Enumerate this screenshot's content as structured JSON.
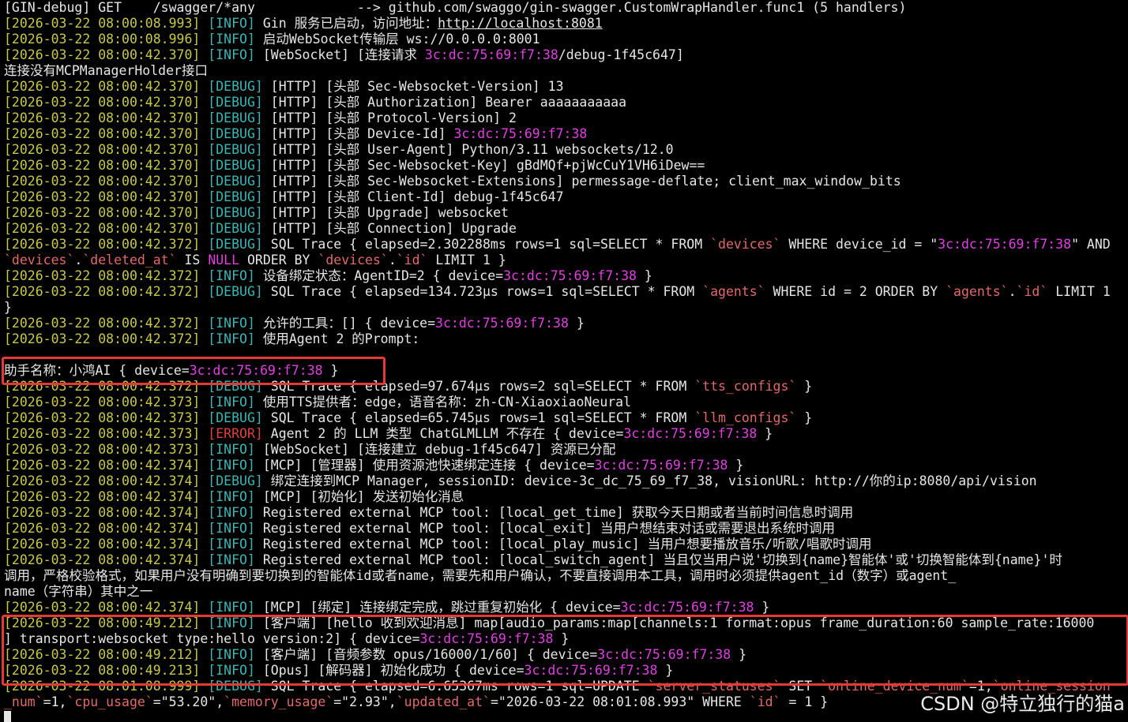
{
  "lines": [
    {
      "segs": [
        {
          "t": "[GIN-debug] GET    /swagger/*any             --> github.com/swaggo/gin-swagger.CustomWrapHandler.func1 (5 handlers)",
          "c": "w"
        }
      ]
    },
    {
      "segs": [
        {
          "t": "[2026-03-22 08:00:08.993]",
          "c": "ts"
        },
        {
          "t": " "
        },
        {
          "t": "[INFO]",
          "c": "info"
        },
        {
          "t": " Gin 服务已启动，访问地址："
        },
        {
          "t": "http://localhost:8081",
          "c": "url"
        }
      ]
    },
    {
      "segs": [
        {
          "t": "[2026-03-22 08:00:08.996]",
          "c": "ts"
        },
        {
          "t": " "
        },
        {
          "t": "[INFO]",
          "c": "info"
        },
        {
          "t": " 启动WebSocket传输层 ws://0.0.0.0:8001"
        }
      ]
    },
    {
      "segs": [
        {
          "t": "[2026-03-22 08:00:42.370]",
          "c": "ts"
        },
        {
          "t": " "
        },
        {
          "t": "[INFO]",
          "c": "info"
        },
        {
          "t": " [WebSocket] [连接请求 "
        },
        {
          "t": "3c:dc:75:69:f7:38",
          "c": "mac"
        },
        {
          "t": "/debug-1f45c647]"
        }
      ]
    },
    {
      "segs": [
        {
          "t": "连接没有MCPManagerHolder接口"
        }
      ]
    },
    {
      "segs": [
        {
          "t": "[2026-03-22 08:00:42.370]",
          "c": "ts"
        },
        {
          "t": " "
        },
        {
          "t": "[DEBUG]",
          "c": "debug"
        },
        {
          "t": " [HTTP] [头部 Sec-Websocket-Version] 13"
        }
      ]
    },
    {
      "segs": [
        {
          "t": "[2026-03-22 08:00:42.370]",
          "c": "ts"
        },
        {
          "t": " "
        },
        {
          "t": "[DEBUG]",
          "c": "debug"
        },
        {
          "t": " [HTTP] [头部 Authorization] Bearer aaaaaaaaaaa"
        }
      ]
    },
    {
      "segs": [
        {
          "t": "[2026-03-22 08:00:42.370]",
          "c": "ts"
        },
        {
          "t": " "
        },
        {
          "t": "[DEBUG]",
          "c": "debug"
        },
        {
          "t": " [HTTP] [头部 Protocol-Version] 2"
        }
      ]
    },
    {
      "segs": [
        {
          "t": "[2026-03-22 08:00:42.370]",
          "c": "ts"
        },
        {
          "t": " "
        },
        {
          "t": "[DEBUG]",
          "c": "debug"
        },
        {
          "t": " [HTTP] [头部 Device-Id] "
        },
        {
          "t": "3c:dc:75:69:f7:38",
          "c": "mac"
        }
      ]
    },
    {
      "segs": [
        {
          "t": "[2026-03-22 08:00:42.370]",
          "c": "ts"
        },
        {
          "t": " "
        },
        {
          "t": "[DEBUG]",
          "c": "debug"
        },
        {
          "t": " [HTTP] [头部 User-Agent] Python/3.11 websockets/12.0"
        }
      ]
    },
    {
      "segs": [
        {
          "t": "[2026-03-22 08:00:42.370]",
          "c": "ts"
        },
        {
          "t": " "
        },
        {
          "t": "[DEBUG]",
          "c": "debug"
        },
        {
          "t": " [HTTP] [头部 Sec-Websocket-Key] gBdMQf+pjWcCuY1VH6iDew=="
        }
      ]
    },
    {
      "segs": [
        {
          "t": "[2026-03-22 08:00:42.370]",
          "c": "ts"
        },
        {
          "t": " "
        },
        {
          "t": "[DEBUG]",
          "c": "debug"
        },
        {
          "t": " [HTTP] [头部 Sec-Websocket-Extensions] permessage-deflate; client_max_window_bits"
        }
      ]
    },
    {
      "segs": [
        {
          "t": "[2026-03-22 08:00:42.370]",
          "c": "ts"
        },
        {
          "t": " "
        },
        {
          "t": "[DEBUG]",
          "c": "debug"
        },
        {
          "t": " [HTTP] [头部 Client-Id] debug-1f45c647"
        }
      ]
    },
    {
      "segs": [
        {
          "t": "[2026-03-22 08:00:42.370]",
          "c": "ts"
        },
        {
          "t": " "
        },
        {
          "t": "[DEBUG]",
          "c": "debug"
        },
        {
          "t": " [HTTP] [头部 Upgrade] websocket"
        }
      ]
    },
    {
      "segs": [
        {
          "t": "[2026-03-22 08:00:42.370]",
          "c": "ts"
        },
        {
          "t": " "
        },
        {
          "t": "[DEBUG]",
          "c": "debug"
        },
        {
          "t": " [HTTP] [头部 Connection] Upgrade"
        }
      ]
    },
    {
      "segs": [
        {
          "t": "[2026-03-22 08:00:42.372]",
          "c": "ts"
        },
        {
          "t": " "
        },
        {
          "t": "[DEBUG]",
          "c": "debug"
        },
        {
          "t": " SQL Trace { elapsed=2.302288ms rows=1 sql=SELECT * FROM "
        },
        {
          "t": "`devices`",
          "c": "sql"
        },
        {
          "t": " WHERE device_id = \""
        },
        {
          "t": "3c:dc:75:69:f7:38",
          "c": "mac"
        },
        {
          "t": "\" AND"
        }
      ]
    },
    {
      "segs": [
        {
          "t": "`devices`",
          "c": "sql"
        },
        {
          "t": "."
        },
        {
          "t": "`deleted_at`",
          "c": "sql"
        },
        {
          "t": " IS "
        },
        {
          "t": "NULL",
          "c": "mac"
        },
        {
          "t": " ORDER BY "
        },
        {
          "t": "`devices`",
          "c": "sql"
        },
        {
          "t": "."
        },
        {
          "t": "`id`",
          "c": "sql"
        },
        {
          "t": " LIMIT 1 }"
        }
      ]
    },
    {
      "segs": [
        {
          "t": "[2026-03-22 08:00:42.372]",
          "c": "ts"
        },
        {
          "t": " "
        },
        {
          "t": "[INFO]",
          "c": "info"
        },
        {
          "t": " 设备绑定状态：AgentID=2 { device="
        },
        {
          "t": "3c:dc:75:69:f7:38",
          "c": "mac"
        },
        {
          "t": " }"
        }
      ]
    },
    {
      "segs": [
        {
          "t": "[2026-03-22 08:00:42.372]",
          "c": "ts"
        },
        {
          "t": " "
        },
        {
          "t": "[DEBUG]",
          "c": "debug"
        },
        {
          "t": " SQL Trace { elapsed=134.723µs rows=1 sql=SELECT * FROM "
        },
        {
          "t": "`agents`",
          "c": "sql"
        },
        {
          "t": " WHERE id = 2 ORDER BY "
        },
        {
          "t": "`agents`",
          "c": "sql"
        },
        {
          "t": "."
        },
        {
          "t": "`id`",
          "c": "sql"
        },
        {
          "t": " LIMIT 1"
        }
      ]
    },
    {
      "segs": [
        {
          "t": "}"
        }
      ]
    },
    {
      "segs": [
        {
          "t": "[2026-03-22 08:00:42.372]",
          "c": "ts"
        },
        {
          "t": " "
        },
        {
          "t": "[INFO]",
          "c": "info"
        },
        {
          "t": " 允许的工具：[] { device="
        },
        {
          "t": "3c:dc:75:69:f7:38",
          "c": "mac"
        },
        {
          "t": " }"
        }
      ]
    },
    {
      "segs": [
        {
          "t": "[2026-03-22 08:00:42.372]",
          "c": "ts"
        },
        {
          "t": " "
        },
        {
          "t": "[INFO]",
          "c": "info"
        },
        {
          "t": " 使用Agent 2 的Prompt:"
        }
      ]
    },
    {
      "segs": [
        {
          "t": ""
        }
      ]
    },
    {
      "segs": [
        {
          "t": "助手名称：小鸿AI { device="
        },
        {
          "t": "3c:dc:75:69:f7:38",
          "c": "mac"
        },
        {
          "t": " }"
        }
      ]
    },
    {
      "segs": [
        {
          "t": "[2026-03-22 08:00:42.372]",
          "c": "ts"
        },
        {
          "t": " "
        },
        {
          "t": "[DEBUG]",
          "c": "debug"
        },
        {
          "t": " SQL Trace { elapsed=97.674µs rows=2 sql=SELECT * FROM "
        },
        {
          "t": "`tts_configs`",
          "c": "sql"
        },
        {
          "t": " }"
        }
      ]
    },
    {
      "segs": [
        {
          "t": "[2026-03-22 08:00:42.373]",
          "c": "ts"
        },
        {
          "t": " "
        },
        {
          "t": "[INFO]",
          "c": "info"
        },
        {
          "t": " 使用TTS提供者：edge，语音名称：zh-CN-XiaoxiaoNeural"
        }
      ]
    },
    {
      "segs": [
        {
          "t": "[2026-03-22 08:00:42.373]",
          "c": "ts"
        },
        {
          "t": " "
        },
        {
          "t": "[DEBUG]",
          "c": "debug"
        },
        {
          "t": " SQL Trace { elapsed=65.745µs rows=1 sql=SELECT * FROM "
        },
        {
          "t": "`llm_configs`",
          "c": "sql"
        },
        {
          "t": " }"
        }
      ]
    },
    {
      "segs": [
        {
          "t": "[2026-03-22 08:00:42.373]",
          "c": "ts"
        },
        {
          "t": " "
        },
        {
          "t": "[ERROR]",
          "c": "error"
        },
        {
          "t": " Agent 2 的 LLM 类型 ChatGLMLLM 不存在 { device="
        },
        {
          "t": "3c:dc:75:69:f7:38",
          "c": "mac"
        },
        {
          "t": " }"
        }
      ]
    },
    {
      "segs": [
        {
          "t": "[2026-03-22 08:00:42.373]",
          "c": "ts"
        },
        {
          "t": " "
        },
        {
          "t": "[INFO]",
          "c": "info"
        },
        {
          "t": " [WebSocket] [连接建立 debug-1f45c647] 资源已分配"
        }
      ]
    },
    {
      "segs": [
        {
          "t": "[2026-03-22 08:00:42.374]",
          "c": "ts"
        },
        {
          "t": " "
        },
        {
          "t": "[INFO]",
          "c": "info"
        },
        {
          "t": " [MCP] [管理器] 使用资源池快速绑定连接 { device="
        },
        {
          "t": "3c:dc:75:69:f7:38",
          "c": "mac"
        },
        {
          "t": " }"
        }
      ]
    },
    {
      "segs": [
        {
          "t": "[2026-03-22 08:00:42.374]",
          "c": "ts"
        },
        {
          "t": " "
        },
        {
          "t": "[DEBUG]",
          "c": "debug"
        },
        {
          "t": " 绑定连接到MCP Manager, sessionID: device-3c_dc_75_69_f7_38, visionURL: http://你的ip:8080/api/vision"
        }
      ]
    },
    {
      "segs": [
        {
          "t": "[2026-03-22 08:00:42.374]",
          "c": "ts"
        },
        {
          "t": " "
        },
        {
          "t": "[INFO]",
          "c": "info"
        },
        {
          "t": " [MCP] [初始化] 发送初始化消息"
        }
      ]
    },
    {
      "segs": [
        {
          "t": "[2026-03-22 08:00:42.374]",
          "c": "ts"
        },
        {
          "t": " "
        },
        {
          "t": "[INFO]",
          "c": "info"
        },
        {
          "t": " Registered external MCP tool: [local_get_time] 获取今天日期或者当前时间信息时调用"
        }
      ]
    },
    {
      "segs": [
        {
          "t": "[2026-03-22 08:00:42.374]",
          "c": "ts"
        },
        {
          "t": " "
        },
        {
          "t": "[INFO]",
          "c": "info"
        },
        {
          "t": " Registered external MCP tool: [local_exit] 当用户想结束对话或需要退出系统时调用"
        }
      ]
    },
    {
      "segs": [
        {
          "t": "[2026-03-22 08:00:42.374]",
          "c": "ts"
        },
        {
          "t": " "
        },
        {
          "t": "[INFO]",
          "c": "info"
        },
        {
          "t": " Registered external MCP tool: [local_play_music] 当用户想要播放音乐/听歌/唱歌时调用"
        }
      ]
    },
    {
      "segs": [
        {
          "t": "[2026-03-22 08:00:42.374]",
          "c": "ts"
        },
        {
          "t": " "
        },
        {
          "t": "[INFO]",
          "c": "info"
        },
        {
          "t": " Registered external MCP tool: [local_switch_agent] 当且仅当用户说'切换到{name}智能体'或'切换智能体到{name}'时"
        }
      ]
    },
    {
      "segs": [
        {
          "t": "调用，严格校验格式，如果用户没有明确到要切换到的智能体id或者name，需要先和用户确认，不要直接调用本工具，调用时必须提供agent_id（数字）或agent_"
        }
      ]
    },
    {
      "segs": [
        {
          "t": "name（字符串）其中之一"
        }
      ]
    },
    {
      "segs": [
        {
          "t": "[2026-03-22 08:00:42.374]",
          "c": "ts"
        },
        {
          "t": " "
        },
        {
          "t": "[INFO]",
          "c": "info"
        },
        {
          "t": " [MCP] [绑定] 连接绑定完成，跳过重复初始化 { device="
        },
        {
          "t": "3c:dc:75:69:f7:38",
          "c": "mac"
        },
        {
          "t": " }"
        }
      ]
    },
    {
      "segs": [
        {
          "t": "[2026-03-22 08:00:49.212]",
          "c": "ts"
        },
        {
          "t": " "
        },
        {
          "t": "[INFO]",
          "c": "info"
        },
        {
          "t": " [客户端] [hello 收到欢迎消息] map[audio_params:map[channels:1 format:opus frame_duration:60 sample_rate:16000"
        }
      ]
    },
    {
      "segs": [
        {
          "t": "] transport:websocket type:hello version:2] { device="
        },
        {
          "t": "3c:dc:75:69:f7:38",
          "c": "mac"
        },
        {
          "t": " }"
        }
      ]
    },
    {
      "segs": [
        {
          "t": "[2026-03-22 08:00:49.212]",
          "c": "ts"
        },
        {
          "t": " "
        },
        {
          "t": "[INFO]",
          "c": "info"
        },
        {
          "t": " [客户端] [音频参数 opus/16000/1/60] { device="
        },
        {
          "t": "3c:dc:75:69:f7:38",
          "c": "mac"
        },
        {
          "t": " }"
        }
      ]
    },
    {
      "segs": [
        {
          "t": "[2026-03-22 08:00:49.213]",
          "c": "ts"
        },
        {
          "t": " "
        },
        {
          "t": "[INFO]",
          "c": "info"
        },
        {
          "t": " [Opus] [解码器] 初始化成功 { device="
        },
        {
          "t": "3c:dc:75:69:f7:38",
          "c": "mac"
        },
        {
          "t": " }"
        }
      ]
    },
    {
      "segs": [
        {
          "t": "[2026-03-22 08:01:08.999]",
          "c": "ts"
        },
        {
          "t": " "
        },
        {
          "t": "[DEBUG]",
          "c": "debug"
        },
        {
          "t": " SQL Trace { elapsed=6.65367ms rows=1 sql=UPDATE "
        },
        {
          "t": "`server_statuses`",
          "c": "sql"
        },
        {
          "t": " SET "
        },
        {
          "t": "`online_device_num`",
          "c": "sql"
        },
        {
          "t": "=1,"
        },
        {
          "t": "`online_session",
          "c": "sql"
        }
      ]
    },
    {
      "segs": [
        {
          "t": "_num`",
          "c": "sql"
        },
        {
          "t": "=1,"
        },
        {
          "t": "`cpu_usage`",
          "c": "sql"
        },
        {
          "t": "=\"53.20\","
        },
        {
          "t": "`memory_usage`",
          "c": "sql"
        },
        {
          "t": "=\"2.93\","
        },
        {
          "t": "`updated_at`",
          "c": "sql"
        },
        {
          "t": "=\"2026-03-22 08:01:08.993\" WHERE "
        },
        {
          "t": "`id`",
          "c": "sql"
        },
        {
          "t": " = 1 }"
        }
      ]
    }
  ],
  "watermark": "CSDN @特立独行的猫a"
}
